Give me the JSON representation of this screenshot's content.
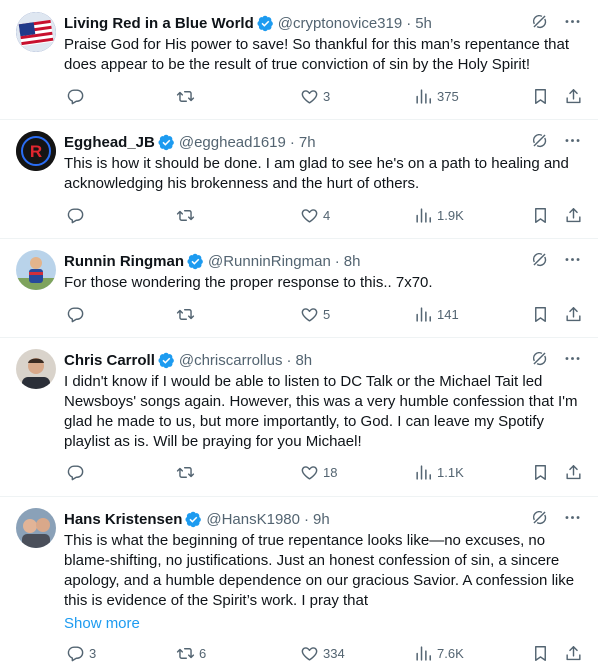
{
  "tweets": [
    {
      "name": "Living Red in a Blue World",
      "handle": "@cryptonovice319",
      "time": "5h",
      "text": "Praise God for His power to save! So thankful for this man’s repentance that does appear to be the result of true conviction of sin by the Holy Spirit!",
      "replies": "",
      "reposts": "",
      "likes": "3",
      "views": "375"
    },
    {
      "name": "Egghead_JB",
      "handle": "@egghead1619",
      "time": "7h",
      "text": "This is how it should be done. I am glad to see he's on a path to healing and acknowledging his brokenness and the hurt of others.",
      "replies": "",
      "reposts": "",
      "likes": "4",
      "views": "1.9K"
    },
    {
      "name": "Runnin Ringman",
      "handle": "@RunninRingman",
      "time": "8h",
      "text": "For those wondering the proper response to this.. 7x70.",
      "replies": "",
      "reposts": "",
      "likes": "5",
      "views": "141"
    },
    {
      "name": "Chris Carroll",
      "handle": "@chriscarrollus",
      "time": "8h",
      "text": "I didn't know if I would be able to listen to DC Talk or the Michael Tait led Newsboys' songs again.  However, this was a very humble confession that I'm glad he made to us, but more importantly, to God. I can leave my Spotify playlist as is. Will be praying for you Michael!",
      "replies": "",
      "reposts": "",
      "likes": "18",
      "views": "1.1K"
    },
    {
      "name": "Hans Kristensen",
      "handle": "@HansK1980",
      "time": "9h",
      "text": "This is what the beginning of true repentance looks like—no excuses, no blame-shifting, no justifications. Just an honest confession of sin, a sincere apology, and a humble dependence on our gracious Savior. A confession like this is evidence of the Spirit’s work. I pray that",
      "show_more": "Show more",
      "replies": "3",
      "reposts": "6",
      "likes": "334",
      "views": "7.6K"
    }
  ],
  "icons": {
    "verified": "verified-badge-icon",
    "grok": "grok-icon",
    "more": "more-icon",
    "reply": "reply-icon",
    "repost": "repost-icon",
    "like": "like-icon",
    "views": "views-icon",
    "bookmark": "bookmark-icon",
    "share": "share-icon"
  },
  "colors": {
    "verified": "#1d9bf0",
    "muted": "#536471",
    "link": "#1d9bf0",
    "text": "#0f1419"
  },
  "separator": "·"
}
